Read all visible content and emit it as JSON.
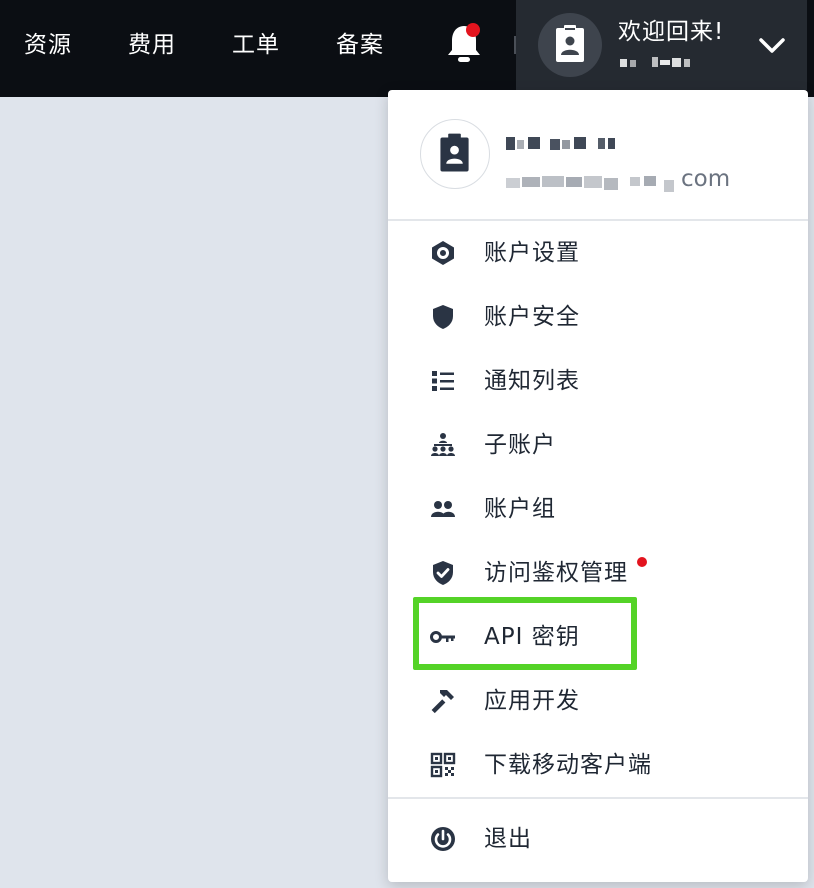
{
  "topnav": {
    "items": [
      {
        "label": "资源"
      },
      {
        "label": "费用"
      },
      {
        "label": "工单"
      },
      {
        "label": "备案"
      }
    ],
    "bell_icon": "bell-icon",
    "notification_dot_color": "#e3141e"
  },
  "user": {
    "welcome": "欢迎回来!",
    "email_tld": "com"
  },
  "menu": {
    "items": [
      {
        "label": "账户设置",
        "icon": "hexagon-gear-icon"
      },
      {
        "label": "账户安全",
        "icon": "shield-icon"
      },
      {
        "label": "通知列表",
        "icon": "list-icon"
      },
      {
        "label": "子账户",
        "icon": "org-tree-icon"
      },
      {
        "label": "账户组",
        "icon": "group-icon"
      },
      {
        "label": "访问鉴权管理",
        "icon": "shield-check-icon",
        "has_badge": true
      },
      {
        "label": "API 密钥",
        "icon": "key-icon",
        "highlighted": true
      },
      {
        "label": "应用开发",
        "icon": "hammer-icon"
      },
      {
        "label": "下载移动客户端",
        "icon": "qr-code-icon"
      }
    ],
    "logout": {
      "label": "退出",
      "icon": "power-icon"
    }
  },
  "colors": {
    "topbar": "#0b0e13",
    "user_area": "#252a31",
    "page_background": "#dfe4ec",
    "highlight": "#54d327",
    "text": "#1f2733"
  }
}
